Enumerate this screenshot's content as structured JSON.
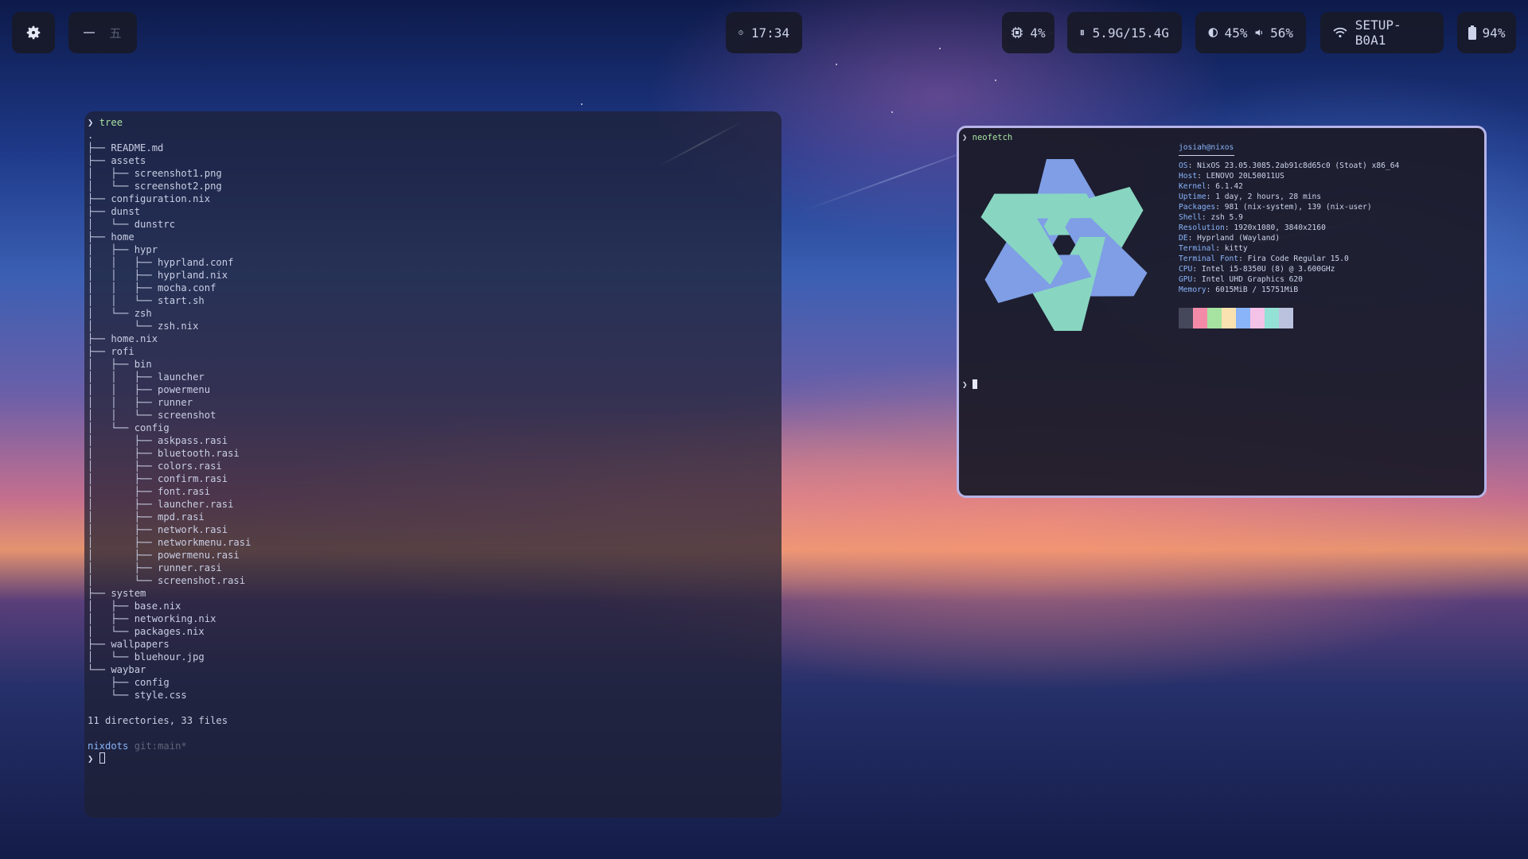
{
  "bar": {
    "clock": "17:34",
    "cpu": "4%",
    "memory": "5.9G/15.4G",
    "brightness": "45%",
    "volume": "56%",
    "network": "SETUP-B0A1",
    "battery": "94%",
    "workspace_inactive": "五"
  },
  "tree_terminal": {
    "command": "tree",
    "lines": [
      ".",
      "├── README.md",
      "├── assets",
      "│   ├── screenshot1.png",
      "│   └── screenshot2.png",
      "├── configuration.nix",
      "├── dunst",
      "│   └── dunstrc",
      "├── home",
      "│   ├── hypr",
      "│   │   ├── hyprland.conf",
      "│   │   ├── hyprland.nix",
      "│   │   ├── mocha.conf",
      "│   │   └── start.sh",
      "│   └── zsh",
      "│       └── zsh.nix",
      "├── home.nix",
      "├── rofi",
      "│   ├── bin",
      "│   │   ├── launcher",
      "│   │   ├── powermenu",
      "│   │   ├── runner",
      "│   │   └── screenshot",
      "│   └── config",
      "│       ├── askpass.rasi",
      "│       ├── bluetooth.rasi",
      "│       ├── colors.rasi",
      "│       ├── confirm.rasi",
      "│       ├── font.rasi",
      "│       ├── launcher.rasi",
      "│       ├── mpd.rasi",
      "│       ├── network.rasi",
      "│       ├── networkmenu.rasi",
      "│       ├── powermenu.rasi",
      "│       ├── runner.rasi",
      "│       └── screenshot.rasi",
      "├── system",
      "│   ├── base.nix",
      "│   ├── networking.nix",
      "│   └── packages.nix",
      "├── wallpapers",
      "│   └── bluehour.jpg",
      "└── waybar",
      "    ├── config",
      "    └── style.css",
      "",
      "11 directories, 33 files",
      ""
    ],
    "cwd": "nixdots",
    "git": "git:main*"
  },
  "neofetch_terminal": {
    "command": "neofetch",
    "user_host": "josiah@nixos",
    "info": [
      {
        "key": "OS",
        "value": "NixOS 23.05.3085.2ab91c8d65c0 (Stoat) x86_64"
      },
      {
        "key": "Host",
        "value": "LENOVO 20L50011US"
      },
      {
        "key": "Kernel",
        "value": "6.1.42"
      },
      {
        "key": "Uptime",
        "value": "1 day, 2 hours, 28 mins"
      },
      {
        "key": "Packages",
        "value": "981 (nix-system), 139 (nix-user)"
      },
      {
        "key": "Shell",
        "value": "zsh 5.9"
      },
      {
        "key": "Resolution",
        "value": "1920x1080, 3840x2160"
      },
      {
        "key": "DE",
        "value": "Hyprland (Wayland)"
      },
      {
        "key": "Terminal",
        "value": "kitty"
      },
      {
        "key": "Terminal Font",
        "value": "Fira Code Regular 15.0"
      },
      {
        "key": "CPU",
        "value": "Intel i5-8350U (8) @ 3.600GHz"
      },
      {
        "key": "GPU",
        "value": "Intel UHD Graphics 620"
      },
      {
        "key": "Memory",
        "value": "6015MiB / 15751MiB"
      }
    ],
    "swatch_colors": [
      "#45475a",
      "#f38ba8",
      "#a6e3a1",
      "#f9e2af",
      "#89b4fa",
      "#f5c2e7",
      "#94e2d5",
      "#bac2de"
    ],
    "logo_colors": {
      "blue": "#7f9ee6",
      "teal": "#88d6c1"
    }
  },
  "colors": {
    "accent_green": "#a6e3a1",
    "accent_blue": "#89b4fa",
    "border": "#b7b4e8"
  }
}
